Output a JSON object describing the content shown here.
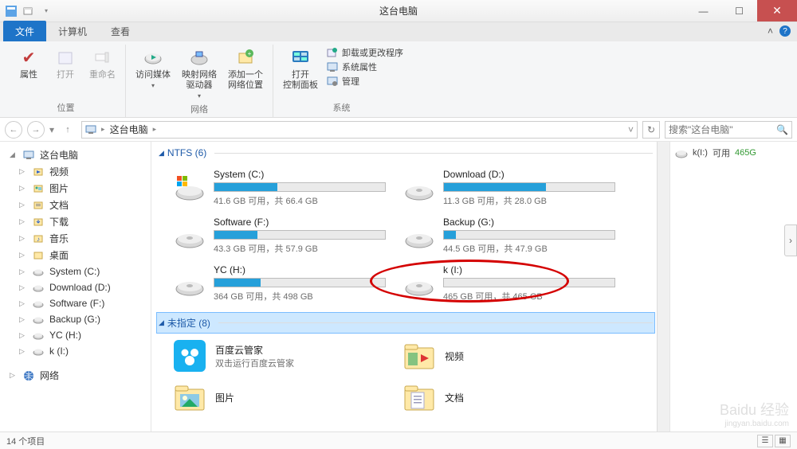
{
  "window": {
    "title": "这台电脑"
  },
  "tabs": {
    "file": "文件",
    "computer": "计算机",
    "view": "查看"
  },
  "ribbon": {
    "group_location": "位置",
    "group_network": "网络",
    "group_system": "系统",
    "properties": "属性",
    "open": "打开",
    "rename": "重命名",
    "access_media": "访问媒体",
    "map_drive": "映射网络\n驱动器",
    "add_net_loc": "添加一个\n网络位置",
    "open_ctrl": "打开\n控制面板",
    "uninstall": "卸载或更改程序",
    "sys_props": "系统属性",
    "manage": "管理"
  },
  "addressbar": {
    "root": "这台电脑"
  },
  "search": {
    "placeholder": "搜索\"这台电脑\""
  },
  "sidebar": {
    "root": "这台电脑",
    "items": [
      {
        "label": "视频"
      },
      {
        "label": "图片"
      },
      {
        "label": "文档"
      },
      {
        "label": "下载"
      },
      {
        "label": "音乐"
      },
      {
        "label": "桌面"
      },
      {
        "label": "System (C:)"
      },
      {
        "label": "Download (D:)"
      },
      {
        "label": "Software (F:)"
      },
      {
        "label": "Backup (G:)"
      },
      {
        "label": "YC (H:)"
      },
      {
        "label": "k (I:)"
      }
    ],
    "network": "网络"
  },
  "sections": {
    "ntfs": {
      "label": "NTFS (6)"
    },
    "unspec": {
      "label": "未指定 (8)"
    }
  },
  "drives": [
    {
      "name": "System (C:)",
      "free": "41.6 GB 可用，共 66.4 GB",
      "pct": 37,
      "os": true
    },
    {
      "name": "Download (D:)",
      "free": "11.3 GB 可用，共 28.0 GB",
      "pct": 60
    },
    {
      "name": "Software (F:)",
      "free": "43.3 GB 可用，共 57.9 GB",
      "pct": 25
    },
    {
      "name": "Backup (G:)",
      "free": "44.5 GB 可用，共 47.9 GB",
      "pct": 7
    },
    {
      "name": "YC (H:)",
      "free": "364 GB 可用，共 498 GB",
      "pct": 27
    },
    {
      "name": "k (I:)",
      "free": "465 GB 可用，共 465 GB",
      "pct": 0
    }
  ],
  "folders": [
    {
      "name": "百度云管家",
      "sub": "双击运行百度云管家",
      "icon": "baidu"
    },
    {
      "name": "视频",
      "icon": "video"
    },
    {
      "name": "图片",
      "icon": "pictures"
    },
    {
      "name": "文档",
      "icon": "docs"
    }
  ],
  "rightpane": {
    "drive": "k(I:)",
    "avail_label": "可用",
    "avail_value": "465G"
  },
  "status": {
    "count": "14 个项目"
  },
  "watermark": {
    "brand": "Baidu 经验",
    "url": "jingyan.baidu.com"
  }
}
